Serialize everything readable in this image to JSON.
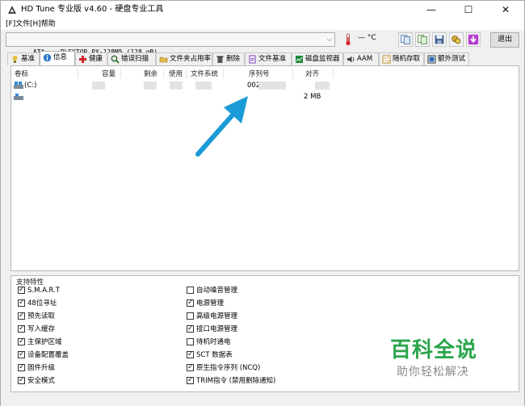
{
  "window": {
    "title": "HD Tune 专业版 v4.60 - 硬盘专业工具",
    "minimize": "—",
    "maximize": "☐",
    "close": "✕"
  },
  "menu": {
    "file": "[F]文件",
    "help": "[H]帮助"
  },
  "toolbar": {
    "drive": "ATA    PLEXTOR PX-128M5 (128 gB)",
    "temperature": "— °C",
    "exit_label": "退出",
    "icons": [
      "copy-info-icon",
      "copy-screen-icon",
      "save-icon",
      "options-icon",
      "download-icon"
    ]
  },
  "tabs": [
    {
      "label": "基准",
      "icon": "benchmark-icon"
    },
    {
      "label": "信息",
      "icon": "info-icon"
    },
    {
      "label": "健康",
      "icon": "health-icon"
    },
    {
      "label": "错误扫描",
      "icon": "error-scan-icon"
    },
    {
      "label": "文件夹占用率",
      "icon": "folder-usage-icon"
    },
    {
      "label": "删除",
      "icon": "erase-icon"
    },
    {
      "label": "文件基准",
      "icon": "file-benchmark-icon"
    },
    {
      "label": "磁盘监视器",
      "icon": "disk-monitor-icon"
    },
    {
      "label": "AAM",
      "icon": "aam-icon"
    },
    {
      "label": "随机存取",
      "icon": "random-access-icon"
    },
    {
      "label": "额外测试",
      "icon": "extra-tests-icon"
    }
  ],
  "info_table": {
    "columns": [
      "卷标",
      "容量",
      "剩余",
      "使用",
      "文件系统",
      "序列号",
      "对齐"
    ],
    "rows": [
      {
        "volume": "(C:)",
        "serial": "002",
        "alignment": ""
      },
      {
        "volume": "",
        "serial": "",
        "alignment": "2 MB"
      }
    ]
  },
  "features": {
    "title": "支持特性",
    "left": [
      {
        "label": "S.M.A.R.T",
        "checked": true
      },
      {
        "label": "48位寻址",
        "checked": true
      },
      {
        "label": "预先读取",
        "checked": true
      },
      {
        "label": "写入缓存",
        "checked": true
      },
      {
        "label": "主保护区域",
        "checked": true
      },
      {
        "label": "设备配置覆盖",
        "checked": true
      },
      {
        "label": "固件升级",
        "checked": true
      },
      {
        "label": "安全模式",
        "checked": true
      }
    ],
    "right": [
      {
        "label": "自动噪音管理",
        "checked": false
      },
      {
        "label": "电源管理",
        "checked": true
      },
      {
        "label": "高级电源管理",
        "checked": false
      },
      {
        "label": "接口电源管理",
        "checked": true
      },
      {
        "label": "待机时通电",
        "checked": false
      },
      {
        "label": "SCT 数据表",
        "checked": true
      },
      {
        "label": "原生指令序列 (NCQ)",
        "checked": true
      },
      {
        "label": "TRIM指令 (禁用删除通知)",
        "checked": true
      }
    ]
  },
  "watermark": {
    "title": "百科全说",
    "subtitle": "助你轻松解决"
  },
  "colors": {
    "arrow": "#1a9ad6",
    "watermark": "#2aa54b"
  }
}
